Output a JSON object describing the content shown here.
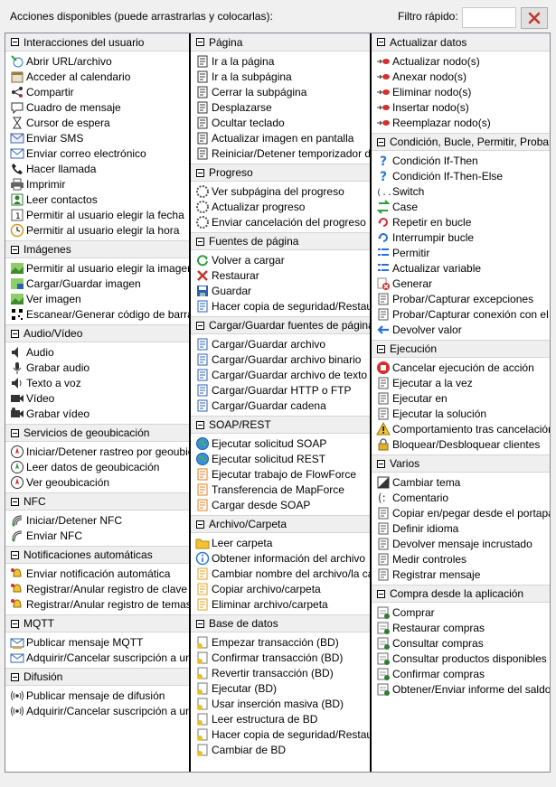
{
  "header": {
    "title": "Acciones disponibles (puede arrastrarlas y colocarlas):",
    "filter_label": "Filtro rápido:",
    "filter_value": "",
    "clear_icon": "red-x-icon"
  },
  "columns": [
    {
      "groups": [
        {
          "title": "Interacciones del usuario",
          "items": [
            {
              "label": "Abrir URL/archivo",
              "icon": "open-url-icon"
            },
            {
              "label": "Acceder al calendario",
              "icon": "calendar-icon"
            },
            {
              "label": "Compartir",
              "icon": "share-icon"
            },
            {
              "label": "Cuadro de mensaje",
              "icon": "message-box-icon"
            },
            {
              "label": "Cursor de espera",
              "icon": "hourglass-icon"
            },
            {
              "label": "Enviar SMS",
              "icon": "sms-icon"
            },
            {
              "label": "Enviar correo electrónico",
              "icon": "email-icon"
            },
            {
              "label": "Hacer llamada",
              "icon": "phone-icon"
            },
            {
              "label": "Imprimir",
              "icon": "printer-icon"
            },
            {
              "label": "Leer contactos",
              "icon": "contacts-icon"
            },
            {
              "label": "Permitir al usuario elegir la fecha",
              "icon": "date-picker-icon"
            },
            {
              "label": "Permitir al usuario elegir la hora",
              "icon": "clock-icon"
            }
          ]
        },
        {
          "title": "Imágenes",
          "items": [
            {
              "label": "Permitir al usuario elegir la imagen",
              "icon": "image-pick-icon"
            },
            {
              "label": "Cargar/Guardar imagen",
              "icon": "image-save-icon"
            },
            {
              "label": "Ver imagen",
              "icon": "image-view-icon"
            },
            {
              "label": "Escanear/Generar código de barras",
              "icon": "barcode-icon"
            }
          ]
        },
        {
          "title": "Audio/Vídeo",
          "items": [
            {
              "label": "Audio",
              "icon": "speaker-icon"
            },
            {
              "label": "Grabar audio",
              "icon": "microphone-icon"
            },
            {
              "label": "Texto a voz",
              "icon": "text-to-speech-icon"
            },
            {
              "label": "Vídeo",
              "icon": "video-icon"
            },
            {
              "label": "Grabar vídeo",
              "icon": "video-camera-icon"
            }
          ]
        },
        {
          "title": "Servicios de geoubicación",
          "items": [
            {
              "label": "Iniciar/Detener rastreo por geoubicación",
              "icon": "geo-track-icon"
            },
            {
              "label": "Leer datos de geoubicación",
              "icon": "geo-read-icon"
            },
            {
              "label": "Ver geoubicación",
              "icon": "geo-view-icon"
            }
          ]
        },
        {
          "title": "NFC",
          "items": [
            {
              "label": "Iniciar/Detener NFC",
              "icon": "nfc-icon"
            },
            {
              "label": "Enviar NFC",
              "icon": "nfc-send-icon"
            }
          ]
        },
        {
          "title": "Notificaciones automáticas",
          "items": [
            {
              "label": "Enviar notificación automática",
              "icon": "bell-send-icon"
            },
            {
              "label": "Registrar/Anular registro de clave",
              "icon": "bell-key-icon"
            },
            {
              "label": "Registrar/Anular registro de temas",
              "icon": "bell-topic-icon"
            }
          ]
        },
        {
          "title": "MQTT",
          "items": [
            {
              "label": "Publicar mensaje MQTT",
              "icon": "mqtt-publish-icon"
            },
            {
              "label": "Adquirir/Cancelar suscripción a un tema",
              "icon": "mqtt-subscribe-icon"
            }
          ]
        },
        {
          "title": "Difusión",
          "items": [
            {
              "label": "Publicar mensaje de difusión",
              "icon": "broadcast-icon"
            },
            {
              "label": "Adquirir/Cancelar suscripción a un tema",
              "icon": "broadcast-subscribe-icon"
            }
          ]
        }
      ]
    },
    {
      "groups": [
        {
          "title": "Página",
          "items": [
            {
              "label": "Ir a la página",
              "icon": "goto-page-icon"
            },
            {
              "label": "Ir a la subpágina",
              "icon": "goto-subpage-icon"
            },
            {
              "label": "Cerrar la subpágina",
              "icon": "close-subpage-icon"
            },
            {
              "label": "Desplazarse",
              "icon": "scroll-icon"
            },
            {
              "label": "Ocultar teclado",
              "icon": "keyboard-icon"
            },
            {
              "label": "Actualizar imagen en pantalla",
              "icon": "refresh-screen-icon"
            },
            {
              "label": "Reiniciar/Detener temporizador de página",
              "icon": "timer-icon"
            }
          ]
        },
        {
          "title": "Progreso",
          "items": [
            {
              "label": "Ver subpágina del progreso",
              "icon": "progress-view-icon"
            },
            {
              "label": "Actualizar progreso",
              "icon": "progress-update-icon"
            },
            {
              "label": "Enviar cancelación del progreso",
              "icon": "progress-cancel-icon"
            }
          ]
        },
        {
          "title": "Fuentes de página",
          "items": [
            {
              "label": "Volver a cargar",
              "icon": "reload-icon"
            },
            {
              "label": "Restaurar",
              "icon": "restore-x-icon"
            },
            {
              "label": "Guardar",
              "icon": "save-icon"
            },
            {
              "label": "Hacer copia de seguridad/Restaurar",
              "icon": "backup-icon"
            }
          ]
        },
        {
          "title": "Cargar/Guardar fuentes de página",
          "items": [
            {
              "label": "Cargar/Guardar archivo",
              "icon": "file-icon"
            },
            {
              "label": "Cargar/Guardar archivo binario",
              "icon": "binary-file-icon"
            },
            {
              "label": "Cargar/Guardar archivo de texto",
              "icon": "text-file-icon"
            },
            {
              "label": "Cargar/Guardar HTTP o FTP",
              "icon": "http-icon"
            },
            {
              "label": "Cargar/Guardar cadena",
              "icon": "string-icon"
            }
          ]
        },
        {
          "title": "SOAP/REST",
          "items": [
            {
              "label": "Ejecutar solicitud SOAP",
              "icon": "globe-icon"
            },
            {
              "label": "Ejecutar solicitud REST",
              "icon": "globe-icon"
            },
            {
              "label": "Ejecutar trabajo de FlowForce",
              "icon": "flowforce-icon"
            },
            {
              "label": "Transferencia de MapForce",
              "icon": "mapforce-icon"
            },
            {
              "label": "Cargar desde SOAP",
              "icon": "soap-load-icon"
            }
          ]
        },
        {
          "title": "Archivo/Carpeta",
          "items": [
            {
              "label": "Leer carpeta",
              "icon": "folder-icon"
            },
            {
              "label": "Obtener información del archivo",
              "icon": "info-icon"
            },
            {
              "label": "Cambiar nombre del archivo/la carpeta",
              "icon": "rename-icon"
            },
            {
              "label": "Copiar archivo/carpeta",
              "icon": "folder-copy-icon"
            },
            {
              "label": "Eliminar archivo/carpeta",
              "icon": "folder-delete-icon"
            }
          ]
        },
        {
          "title": "Base de datos",
          "items": [
            {
              "label": "Empezar transacción (BD)",
              "icon": "db-begin-icon"
            },
            {
              "label": "Confirmar transacción (BD)",
              "icon": "db-commit-icon"
            },
            {
              "label": "Revertir transacción (BD)",
              "icon": "db-rollback-icon"
            },
            {
              "label": "Ejecutar (BD)",
              "icon": "db-execute-icon"
            },
            {
              "label": "Usar inserción masiva (BD)",
              "icon": "db-bulk-icon"
            },
            {
              "label": "Leer estructura de BD",
              "icon": "db-structure-icon"
            },
            {
              "label": "Hacer copia de seguridad/Restaurar",
              "icon": "db-backup-icon"
            },
            {
              "label": "Cambiar de BD",
              "icon": "db-switch-icon"
            }
          ]
        }
      ]
    },
    {
      "groups": [
        {
          "title": "Actualizar datos",
          "items": [
            {
              "label": "Actualizar nodo(s)",
              "icon": "node-update-icon"
            },
            {
              "label": "Anexar nodo(s)",
              "icon": "node-append-icon"
            },
            {
              "label": "Eliminar nodo(s)",
              "icon": "node-delete-icon"
            },
            {
              "label": "Insertar nodo(s)",
              "icon": "node-insert-icon"
            },
            {
              "label": "Reemplazar nodo(s)",
              "icon": "node-replace-icon"
            }
          ]
        },
        {
          "title": "Condición, Bucle, Permitir, Probar",
          "items": [
            {
              "label": "Condición If-Then",
              "icon": "question-icon"
            },
            {
              "label": "Condición If-Then-Else",
              "icon": "question-icon"
            },
            {
              "label": "Switch",
              "icon": "switch-icon"
            },
            {
              "label": "Case",
              "icon": "case-icon"
            },
            {
              "label": "Repetir en bucle",
              "icon": "loop-icon"
            },
            {
              "label": "Interrumpir bucle",
              "icon": "break-loop-icon"
            },
            {
              "label": "Permitir",
              "icon": "list-icon"
            },
            {
              "label": "Actualizar variable",
              "icon": "variable-icon"
            },
            {
              "label": "Generar",
              "icon": "throw-icon"
            },
            {
              "label": "Probar/Capturar excepciones",
              "icon": "try-catch-icon"
            },
            {
              "label": "Probar/Capturar conexión con el servidor",
              "icon": "try-connection-icon"
            },
            {
              "label": "Devolver valor",
              "icon": "return-icon"
            }
          ]
        },
        {
          "title": "Ejecución",
          "items": [
            {
              "label": "Cancelar ejecución de acción",
              "icon": "hand-stop-icon"
            },
            {
              "label": "Ejecutar a la vez",
              "icon": "parallel-icon"
            },
            {
              "label": "Ejecutar en",
              "icon": "run-on-icon"
            },
            {
              "label": "Ejecutar la solución",
              "icon": "run-solution-icon"
            },
            {
              "label": "Comportamiento tras cancelación",
              "icon": "warning-icon"
            },
            {
              "label": "Bloquear/Desbloquear clientes",
              "icon": "lock-icon"
            }
          ]
        },
        {
          "title": "Varios",
          "items": [
            {
              "label": "Cambiar tema",
              "icon": "theme-icon"
            },
            {
              "label": "Comentario",
              "icon": "comment-icon"
            },
            {
              "label": "Copiar en/pegar desde el portapapeles",
              "icon": "clipboard-icon"
            },
            {
              "label": "Definir idioma",
              "icon": "language-icon"
            },
            {
              "label": "Devolver mensaje incrustado",
              "icon": "embedded-message-icon"
            },
            {
              "label": "Medir controles",
              "icon": "measure-icon"
            },
            {
              "label": "Registrar mensaje",
              "icon": "log-icon"
            }
          ]
        },
        {
          "title": "Compra desde la aplicación",
          "items": [
            {
              "label": "Comprar",
              "icon": "purchase-icon"
            },
            {
              "label": "Restaurar compras",
              "icon": "purchase-restore-icon"
            },
            {
              "label": "Consultar compras",
              "icon": "purchase-query-icon"
            },
            {
              "label": "Consultar productos disponibles",
              "icon": "products-query-icon"
            },
            {
              "label": "Confirmar compras",
              "icon": "purchase-confirm-icon"
            },
            {
              "label": "Obtener/Enviar informe del saldo",
              "icon": "receipt-icon"
            }
          ]
        }
      ]
    }
  ]
}
